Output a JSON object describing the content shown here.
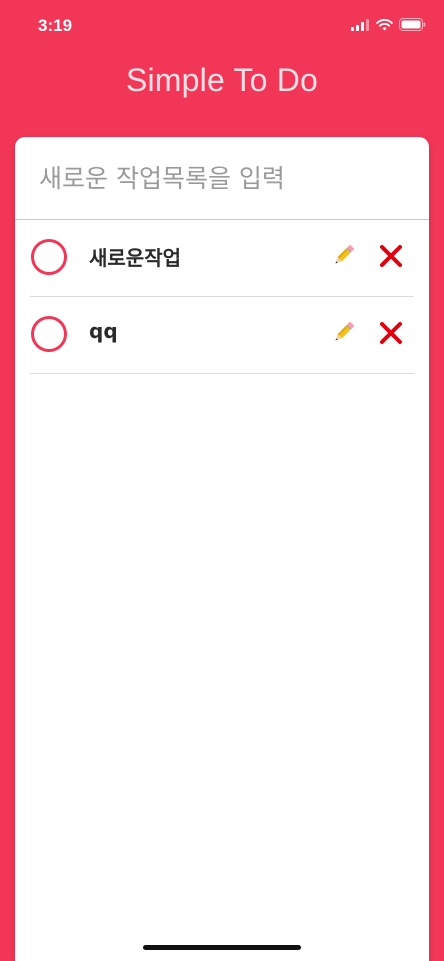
{
  "status_bar": {
    "time": "3:19",
    "icons": [
      "cellular-signal-icon",
      "wifi-icon",
      "battery-icon"
    ]
  },
  "app": {
    "title": "Simple To Do"
  },
  "new_task": {
    "placeholder": "새로운 작업목록을 입력",
    "value": ""
  },
  "todos": [
    {
      "text": "새로운작업",
      "completed": false,
      "edit_icon": "pencil-icon",
      "delete_icon": "close-icon"
    },
    {
      "text": "qq",
      "completed": false,
      "edit_icon": "pencil-icon",
      "delete_icon": "close-icon"
    }
  ],
  "colors": {
    "background": "#f23657",
    "card": "#ffffff",
    "checkbox_border": "#f23657",
    "delete": "#e0000f",
    "text": "#2a2a2a",
    "placeholder": "#9a9a9a"
  }
}
